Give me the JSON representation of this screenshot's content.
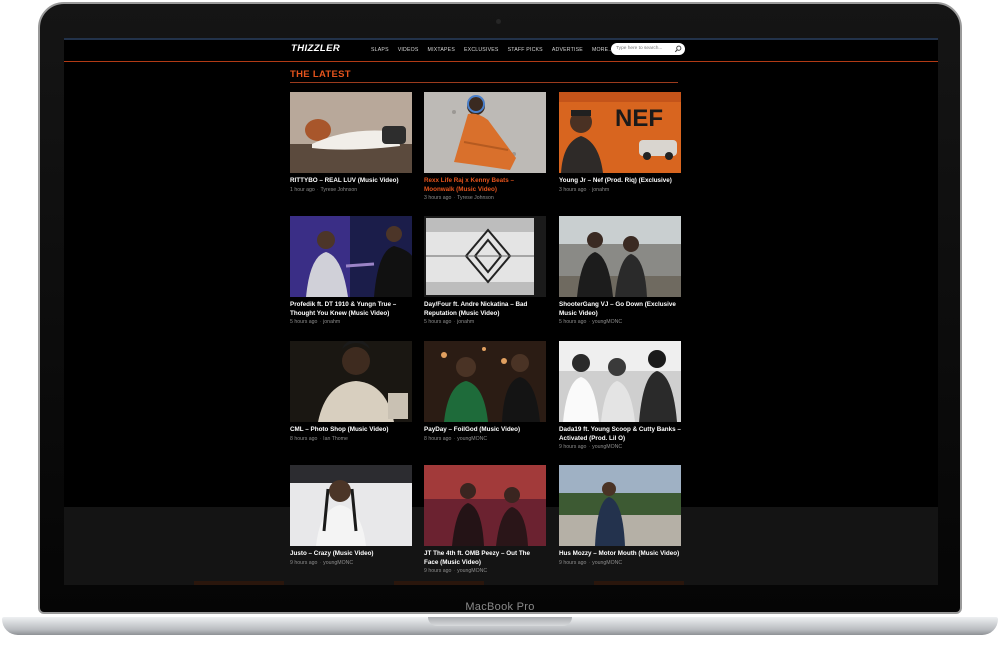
{
  "device": {
    "brand_label": "MacBook Pro"
  },
  "site": {
    "logo": "THIZZLER",
    "nav": [
      "SLAPS",
      "VIDEOS",
      "MIXTAPES",
      "EXCLUSIVES",
      "STAFF PICKS",
      "ADVERTISE",
      "MORE.."
    ],
    "search_placeholder": "Type here to search...",
    "colors": {
      "accent": "#e5531c",
      "background": "#000000",
      "rule": "#b23a15"
    }
  },
  "section_title": "THE LATEST",
  "videos": [
    {
      "title": "RITTYBO – REAL LUV (Music Video)",
      "time": "1 hour ago",
      "author": "Tyrese Johnson",
      "highlighted": false
    },
    {
      "title": "Rexx Life Raj x Kenny Beats – Moonwalk (Music Video)",
      "time": "3 hours ago",
      "author": "Tyrese Johnson",
      "highlighted": true
    },
    {
      "title": "Young Jr – Nef (Prod. Riq) (Exclusive)",
      "time": "3 hours ago",
      "author": "jonahm",
      "highlighted": false,
      "thumb_caption": "NEF"
    },
    {
      "title": "Profedik ft. DT 1910 & Yungn True – Thought You Knew (Music Video)",
      "time": "5 hours ago",
      "author": "jonahm",
      "highlighted": false
    },
    {
      "title": "Day/Four ft. Andre Nickatina – Bad Reputation (Music Video)",
      "time": "5 hours ago",
      "author": "jonahm",
      "highlighted": false
    },
    {
      "title": "ShooterGang VJ – Go Down (Exclusive Music Video)",
      "time": "5 hours ago",
      "author": "youngMONC",
      "highlighted": false
    },
    {
      "title": "CML – Photo Shop (Music Video)",
      "time": "8 hours ago",
      "author": "Ian Thome",
      "highlighted": false
    },
    {
      "title": "PayDay – FoilGod (Music Video)",
      "time": "8 hours ago",
      "author": "youngMONC",
      "highlighted": false
    },
    {
      "title": "Dada19 ft. Young Scoop & Cutty Banks – Activated (Prod. Lil O)",
      "time": "9 hours ago",
      "author": "youngMONC",
      "highlighted": false
    },
    {
      "title": "Justo – Crazy (Music Video)",
      "time": "9 hours ago",
      "author": "youngMONC",
      "highlighted": false
    },
    {
      "title": "JT The 4th ft. OMB Peezy – Out The Face (Music Video)",
      "time": "9 hours ago",
      "author": "youngMONC",
      "highlighted": false
    },
    {
      "title": "Hus Mozzy – Motor Mouth (Music Video)",
      "time": "9 hours ago",
      "author": "youngMONC",
      "highlighted": false
    }
  ]
}
